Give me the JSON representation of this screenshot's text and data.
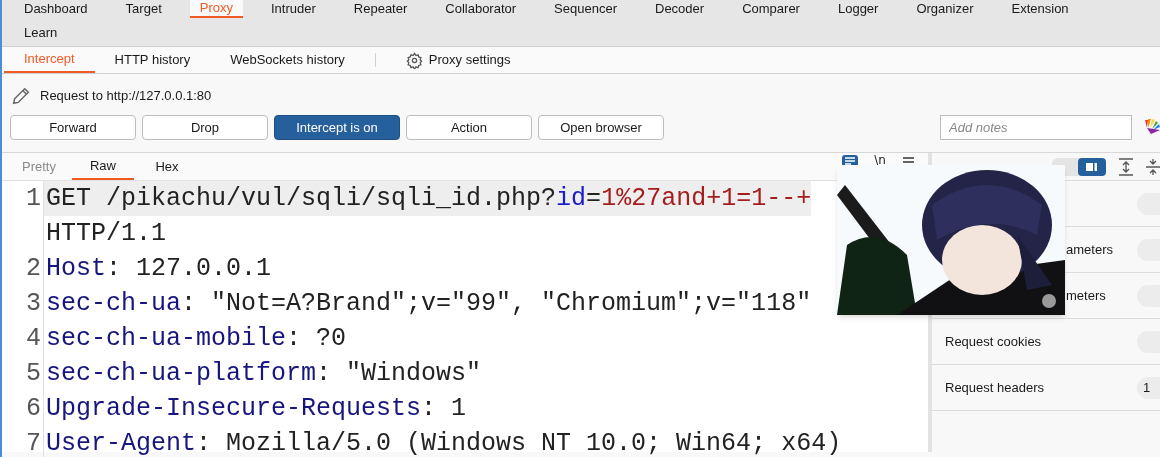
{
  "main_tabs": [
    {
      "label": "Dashboard",
      "selected": false
    },
    {
      "label": "Target",
      "selected": false
    },
    {
      "label": "Proxy",
      "selected": true
    },
    {
      "label": "Intruder",
      "selected": false
    },
    {
      "label": "Repeater",
      "selected": false
    },
    {
      "label": "Collaborator",
      "selected": false
    },
    {
      "label": "Sequencer",
      "selected": false
    },
    {
      "label": "Decoder",
      "selected": false
    },
    {
      "label": "Comparer",
      "selected": false
    },
    {
      "label": "Logger",
      "selected": false
    },
    {
      "label": "Organizer",
      "selected": false
    },
    {
      "label": "Extension",
      "selected": false
    }
  ],
  "main_tabs_second_row": [
    {
      "label": "Learn",
      "selected": false
    }
  ],
  "proxy_tabs": [
    {
      "label": "Intercept",
      "selected": true
    },
    {
      "label": "HTTP history",
      "selected": false
    },
    {
      "label": "WebSockets history",
      "selected": false
    }
  ],
  "proxy_settings": "Proxy settings",
  "request_target": "Request to http://127.0.0.1:80",
  "buttons": [
    {
      "label": "Forward",
      "on": false
    },
    {
      "label": "Drop",
      "on": false
    },
    {
      "label": "Intercept is on",
      "on": true
    },
    {
      "label": "Action",
      "on": false
    },
    {
      "label": "Open browser",
      "on": false
    }
  ],
  "notes": {
    "placeholder": "Add notes"
  },
  "editor_tabs": [
    {
      "label": "Pretty",
      "selected": false,
      "disabled": true
    },
    {
      "label": "Raw",
      "selected": true,
      "disabled": false
    },
    {
      "label": "Hex",
      "selected": false,
      "disabled": false
    }
  ],
  "newline_toggle": "\\n",
  "code_lines": [
    {
      "number": "1",
      "highlighted": true,
      "tokens": [
        {
          "text": "GET /pikachu/vul/sqli/sqli_id.php?",
          "kind": "plain"
        },
        {
          "text": "id",
          "kind": "param"
        },
        {
          "text": "=",
          "kind": "plain"
        },
        {
          "text": "1%27and+1=1--+",
          "kind": "value"
        }
      ],
      "wrapped": [
        {
          "text": "HTTP/1.1",
          "kind": "plain"
        }
      ]
    },
    {
      "number": "2",
      "highlighted": false,
      "tokens": [
        {
          "text": "Host",
          "kind": "header"
        },
        {
          "text": ": 127.0.0.1",
          "kind": "plain"
        }
      ]
    },
    {
      "number": "3",
      "highlighted": false,
      "tokens": [
        {
          "text": "sec-ch-ua",
          "kind": "header"
        },
        {
          "text": ": \"Not=A?Brand\";v=\"99\", \"Chromium\";v=\"118\"",
          "kind": "plain"
        }
      ]
    },
    {
      "number": "4",
      "highlighted": false,
      "tokens": [
        {
          "text": "sec-ch-ua-mobile",
          "kind": "header"
        },
        {
          "text": ": ?0",
          "kind": "plain"
        }
      ]
    },
    {
      "number": "5",
      "highlighted": false,
      "tokens": [
        {
          "text": "sec-ch-ua-platform",
          "kind": "header"
        },
        {
          "text": ": \"Windows\"",
          "kind": "plain"
        }
      ]
    },
    {
      "number": "6",
      "highlighted": false,
      "tokens": [
        {
          "text": "Upgrade-Insecure-Requests",
          "kind": "header"
        },
        {
          "text": ": 1",
          "kind": "plain"
        }
      ]
    },
    {
      "number": "7",
      "highlighted": false,
      "tokens": [
        {
          "text": "User-Agent",
          "kind": "header"
        },
        {
          "text": ": Mozilla/5.0 (Windows NT 10.0; Win64; x64)",
          "kind": "plain"
        }
      ]
    }
  ],
  "inspector": {
    "rows": [
      {
        "partial": true,
        "label": "ameters"
      },
      {
        "partial": true,
        "label": "meters"
      },
      {
        "partial": false,
        "label": "Request cookies"
      },
      {
        "partial": false,
        "label": "Request headers",
        "count": "1"
      }
    ]
  }
}
